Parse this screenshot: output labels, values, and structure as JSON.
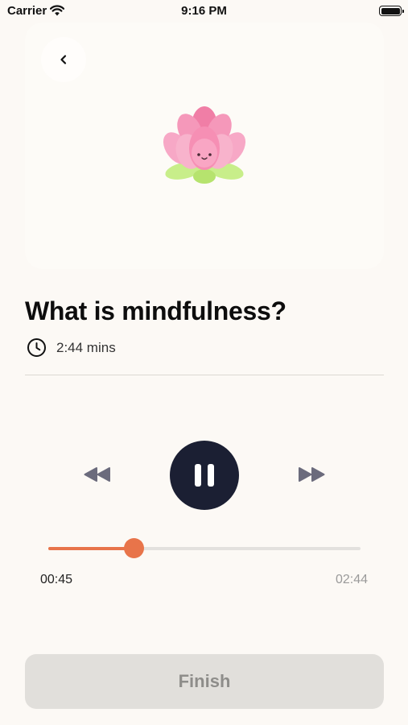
{
  "status_bar": {
    "carrier": "Carrier",
    "time": "9:16 PM",
    "icons": [
      "wifi-icon",
      "battery-icon"
    ]
  },
  "header": {
    "back_icon": "chevron-left-icon",
    "illustration": "lotus-flower-illustration"
  },
  "meditation": {
    "title": "What is mindfulness?",
    "duration_icon": "clock-icon",
    "duration": "2:44 mins"
  },
  "player": {
    "controls": [
      "rewind-icon",
      "pause-icon",
      "fast-forward-icon"
    ],
    "state": "playing",
    "elapsed": "00:45",
    "total": "02:44",
    "progress": 0.274
  },
  "footer": {
    "finish_label": "Finish"
  },
  "colors": {
    "background": "#fcf9f5",
    "accent": "#e8744a",
    "play_button": "#1b1f33",
    "finish_button": "#e1dfdb",
    "finish_text": "#8e8d8a"
  }
}
